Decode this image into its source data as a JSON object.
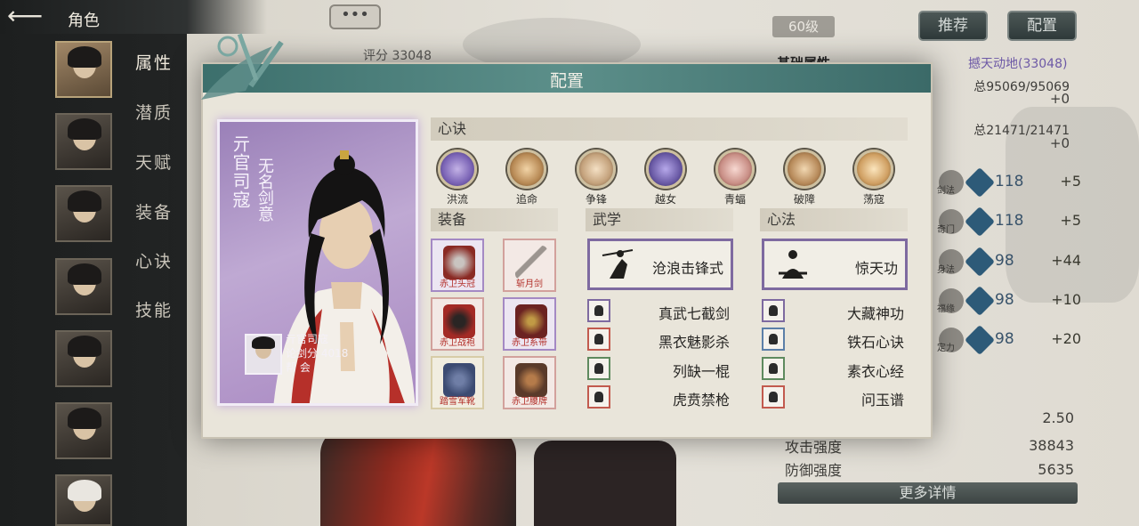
{
  "header": {
    "title": "角色",
    "back_icon": "back-arrow-icon",
    "chat_icon": "chat-bubble-icon",
    "chat_label": "•••"
  },
  "sidebar": {
    "tabs": [
      "属性",
      "潜质",
      "天赋",
      "装备",
      "心诀",
      "技能"
    ]
  },
  "background": {
    "score_label": "评分 33048",
    "level": "60级",
    "recommend_label": "推荐",
    "config_label": "配置",
    "basic_attr_title": "基础属性",
    "attr_link": "撼天动地(33048)",
    "hp_total": "总95069/95069",
    "hp_plus": "+0",
    "mp_total": "总21471/21471",
    "mp_plus": "+0",
    "attr_rows": [
      {
        "mini": "剑法",
        "value": "118",
        "plus": "+5"
      },
      {
        "mini": "奇门",
        "value": "118",
        "plus": "+5"
      },
      {
        "mini": "身法",
        "value": "98",
        "plus": "+44"
      },
      {
        "mini": "福缘",
        "value": "98",
        "plus": "+10"
      },
      {
        "mini": "定力",
        "value": "98",
        "plus": "+20"
      }
    ],
    "stat_value_top": "2.50",
    "attack_label": "攻击强度",
    "attack_value": "38843",
    "defense_label": "防御强度",
    "defense_value": "5635",
    "more_details": "更多详情",
    "colors": {
      "accent_teal": "#3c6f6c",
      "purple_link": "#6d59a6"
    }
  },
  "modal": {
    "title": "配置",
    "card": {
      "name_vertical": "亓官司寇",
      "title_vertical": "无名剑意",
      "name": "亓官司寇",
      "score_label": "论剑分",
      "score": "4018",
      "guild_label": "帮  会"
    },
    "mind_section": "心诀",
    "mind_skills": [
      {
        "label": "洪流",
        "icon": "vortex-icon",
        "color": "#7a63b5"
      },
      {
        "label": "追命",
        "icon": "dash-icon",
        "color": "#b88a55"
      },
      {
        "label": "争锋",
        "icon": "fist-icon",
        "color": "#c4a27c"
      },
      {
        "label": "越女",
        "icon": "swirl-icon",
        "color": "#6a5aa5"
      },
      {
        "label": "青蝠",
        "icon": "bat-icon",
        "color": "#c98f86"
      },
      {
        "label": "破障",
        "icon": "burst-icon",
        "color": "#b78a5a"
      },
      {
        "label": "荡寇",
        "icon": "flame-icon",
        "color": "#d0a063"
      }
    ],
    "equip_section": "装备",
    "equipment": [
      {
        "label": "赤卫头冠",
        "icon": "helmet-icon",
        "border": "#a489c4",
        "color": "#8a2a24"
      },
      {
        "label": "斩月剑",
        "icon": "sword-icon",
        "border": "#d2a19c",
        "color": "#9c9590"
      },
      {
        "label": "赤卫战袍",
        "icon": "armor-icon",
        "border": "#d2a19c",
        "color": "#a32a25"
      },
      {
        "label": "赤卫系带",
        "icon": "belt-icon",
        "border": "#a489c4",
        "color": "#6b2222"
      },
      {
        "label": "踏雪军靴",
        "icon": "boots-icon",
        "border": "#d7cca7",
        "color": "#3c4b72"
      },
      {
        "label": "赤卫腰牌",
        "icon": "token-icon",
        "border": "#d2a19c",
        "color": "#5a3a2a"
      }
    ],
    "martial_section": "武学",
    "martial_main": "沧浪击锋式",
    "martial_list": [
      {
        "name": "真武七截剑",
        "border": "#7e6aa0"
      },
      {
        "name": "黑衣魅影杀",
        "border": "#c25a4e"
      },
      {
        "name": "列缺一棍",
        "border": "#5e8a5e"
      },
      {
        "name": "虎贲禁枪",
        "border": "#c25a4e"
      }
    ],
    "mental_section": "心法",
    "mental_main": "惊天功",
    "mental_list": [
      {
        "name": "大藏神功",
        "border": "#7e6aa0"
      },
      {
        "name": "铁石心诀",
        "border": "#5b7fa8"
      },
      {
        "name": "素衣心经",
        "border": "#5e8a5e"
      },
      {
        "name": "问玉谱",
        "border": "#c25a4e"
      }
    ]
  }
}
